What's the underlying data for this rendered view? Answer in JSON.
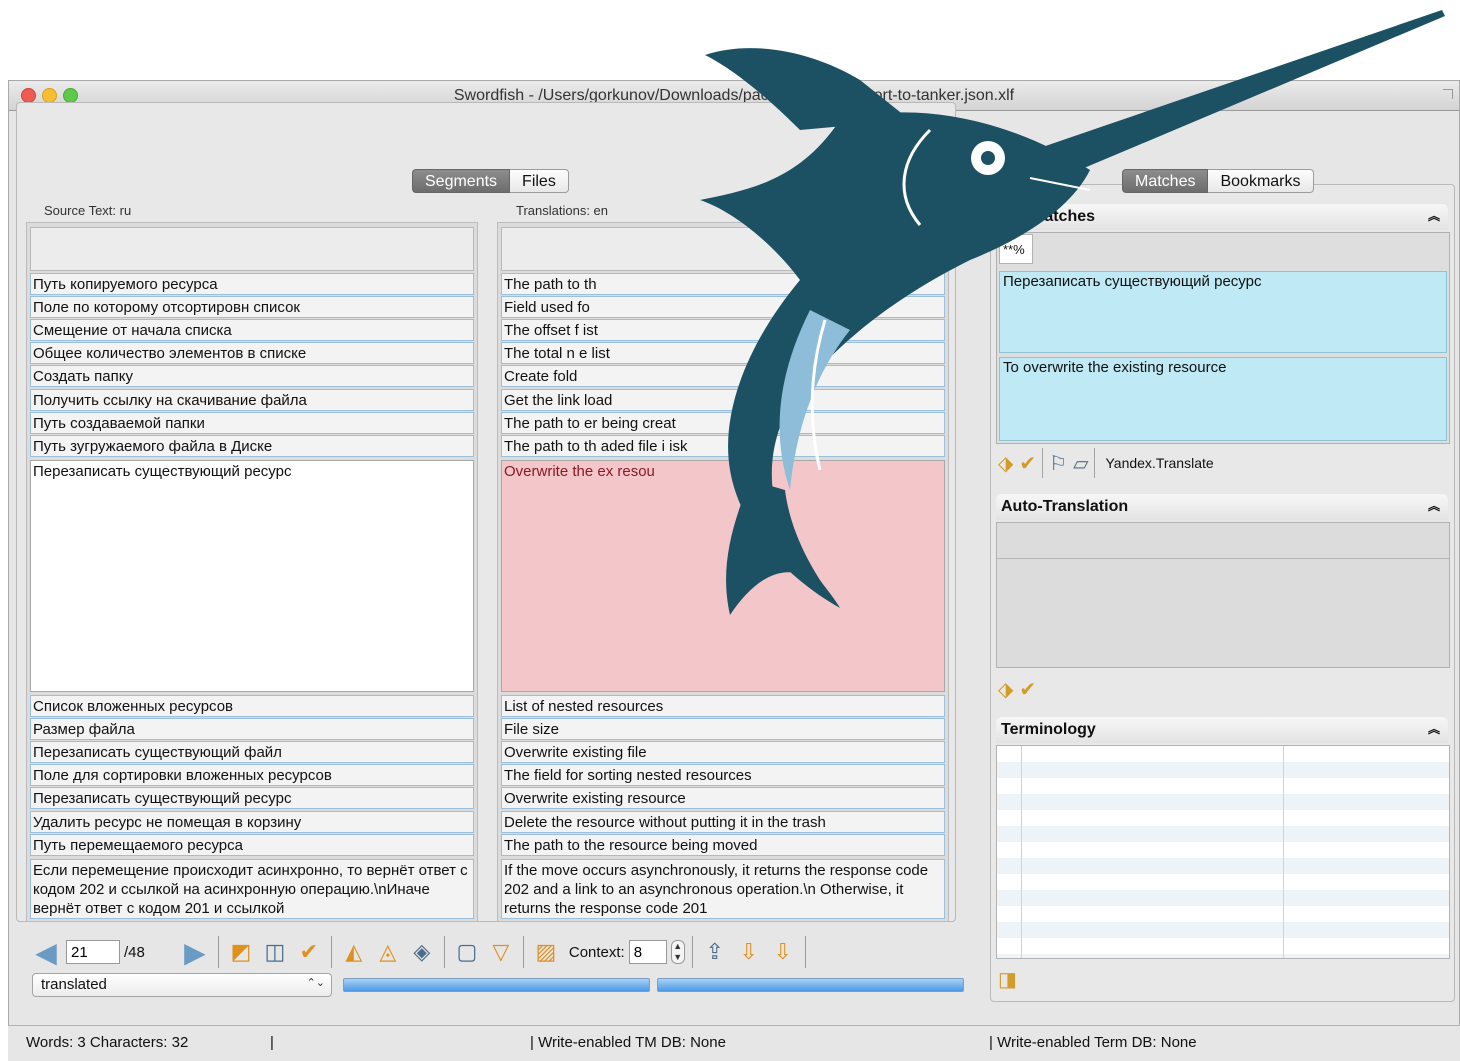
{
  "window": {
    "title": "Swordfish - /Users/gorkunov/Downloads/pack13...k-api-export-to-tanker.json.xlf"
  },
  "toolbar_icons": [
    "open-icon",
    "save-icon",
    "export-icon",
    "import-icon",
    "merge-icon",
    "split-icon",
    "join-icon",
    "find-icon",
    "search-icon",
    "replace-icon",
    "filter-icon",
    "link-icon",
    "copy-icon",
    "tm-icon",
    "tm-import-icon",
    "tm-export-icon",
    "term-icon",
    "term-import-icon",
    "paste-icon"
  ],
  "segments_tabs": [
    "Segments",
    "Files"
  ],
  "right_tabs": [
    "Matches",
    "Bookmarks"
  ],
  "source_header": "Source Text: ru",
  "target_header": "Translations: en",
  "source_rows": [
    "Путь копируемого ресурса",
    "Поле по которому отсортировн список",
    "Смещение от начала списка",
    "Общее количество элементов в списке",
    "Создать папку",
    "Получить ссылку на скачивание файла",
    "Путь создаваемой папки",
    "Путь зугружаемого файла в Диске"
  ],
  "target_rows": [
    "The path to th",
    "Field used fo",
    "The offset f                             ist",
    "The total n                       e list",
    "Create fold",
    "Get the link                     load",
    "The path to             er being creat",
    "The path to th          aded file i     isk"
  ],
  "source_editor": "Перезаписать существующий ресурс",
  "target_editor": "Overwrite the ex                 resou",
  "source_rows_below": [
    "Список вложенных ресурсов",
    "Размер файла",
    "Перезаписать существующий файл",
    "Поле для сортировки вложенных ресурсов",
    "Перезаписать существующий ресурс",
    "Удалить ресурс не помещая в корзину",
    "Путь перемещаемого ресурса"
  ],
  "target_rows_below": [
    "List of nested resources",
    "File size",
    "Overwrite existing file",
    "The field for sorting nested resources",
    "Overwrite existing resource",
    "Delete the resource without putting it in the trash",
    "The path to the resource being moved"
  ],
  "source_last": "Если перемещение происходит асинхронно, то вернёт ответ с кодом 202 и ссылкой на асинхронную операцию.\\nИначе вернёт ответ с кодом 201 и ссылкой",
  "target_last": "If the move occurs asynchronously, it returns the response code 202 and a link to an asynchronous operation.\\n Otherwise, it returns the response code 201",
  "nav": {
    "current": "21",
    "total": "/48",
    "context_label": "Context:",
    "context_value": "8",
    "status": "translated"
  },
  "matches": {
    "title": "Matches",
    "percent": "**%",
    "source": "Перезаписать существующий ресурс",
    "target": "To overwrite the existing resource",
    "engine": "Yandex.Translate"
  },
  "auto_translation": {
    "title": "Auto-Translation"
  },
  "terminology": {
    "title": "Terminology"
  },
  "statusbar": {
    "counts": "Words: 3 Characters: 32",
    "sep1": "|",
    "tm": "|  Write-enabled TM DB: None",
    "term": "|  Write-enabled Term DB: None"
  },
  "colors": {
    "editor_pink": "#f3c6c9",
    "match_blue": "#bfe9f4",
    "logo": "#1c5063"
  }
}
